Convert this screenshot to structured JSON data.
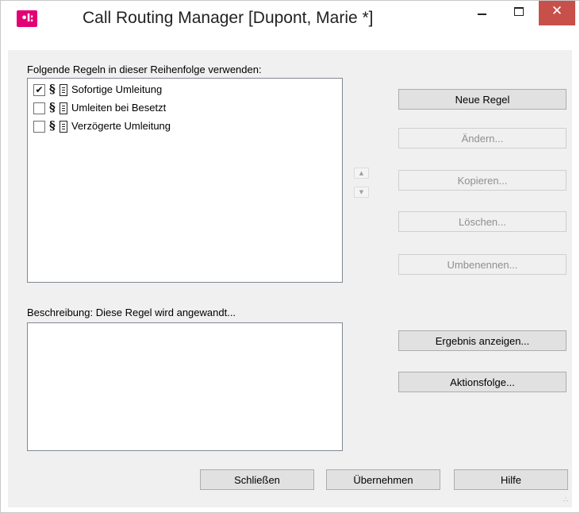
{
  "window": {
    "title": "Call Routing Manager [Dupont, Marie *]",
    "icon": "telekom-app-icon",
    "app_icon_glyph": "•I:",
    "minimize_glyph": "minimize",
    "maximize_glyph": "maximize",
    "close_glyph": "✕",
    "close_color": "#c7504a",
    "accent_color": "#e20074"
  },
  "rules_section": {
    "label": "Folgende Regeln in dieser Reihenfolge verwenden:",
    "rules": [
      {
        "label": "Sofortige Umleitung",
        "checked": true,
        "check_glyph": "✔",
        "para_glyph": "§",
        "icon": "rule-document-icon"
      },
      {
        "label": "Umleiten bei Besetzt",
        "checked": false,
        "check_glyph": "",
        "para_glyph": "§",
        "icon": "rule-document-icon"
      },
      {
        "label": "Verzögerte Umleitung",
        "checked": false,
        "check_glyph": "",
        "para_glyph": "§",
        "icon": "rule-document-icon"
      }
    ]
  },
  "order_controls": {
    "up_glyph": "▲",
    "down_glyph": "▼"
  },
  "rule_buttons": {
    "new_rule": "Neue Regel",
    "edit": "Ändern...",
    "copy": "Kopieren...",
    "delete": "Löschen...",
    "rename": "Umbenennen..."
  },
  "description_section": {
    "label": "Beschreibung: Diese Regel wird angewandt..."
  },
  "result_buttons": {
    "show_result": "Ergebnis anzeigen...",
    "action_sequence": "Aktionsfolge..."
  },
  "footer_buttons": {
    "close": "Schließen",
    "apply": "Übernehmen",
    "help": "Hilfe"
  },
  "resize_grip_glyph": "∴"
}
